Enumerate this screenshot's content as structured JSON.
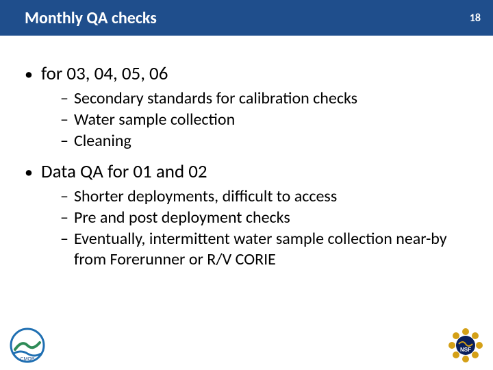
{
  "header": {
    "title": "Monthly QA checks",
    "page_number": "18"
  },
  "bullets": [
    {
      "text": "for 03, 04, 05, 06",
      "sub": [
        "Secondary standards for calibration checks",
        "Water sample collection",
        "Cleaning"
      ]
    },
    {
      "text": "Data QA for 01 and 02",
      "sub": [
        "Shorter deployments, difficult to access",
        "Pre and post deployment checks",
        "Eventually, intermittent water sample collection near-by from Forerunner or R/V CORIE"
      ]
    }
  ],
  "logos": {
    "left_name": "cmop-logo",
    "right_name": "nsf-logo"
  }
}
